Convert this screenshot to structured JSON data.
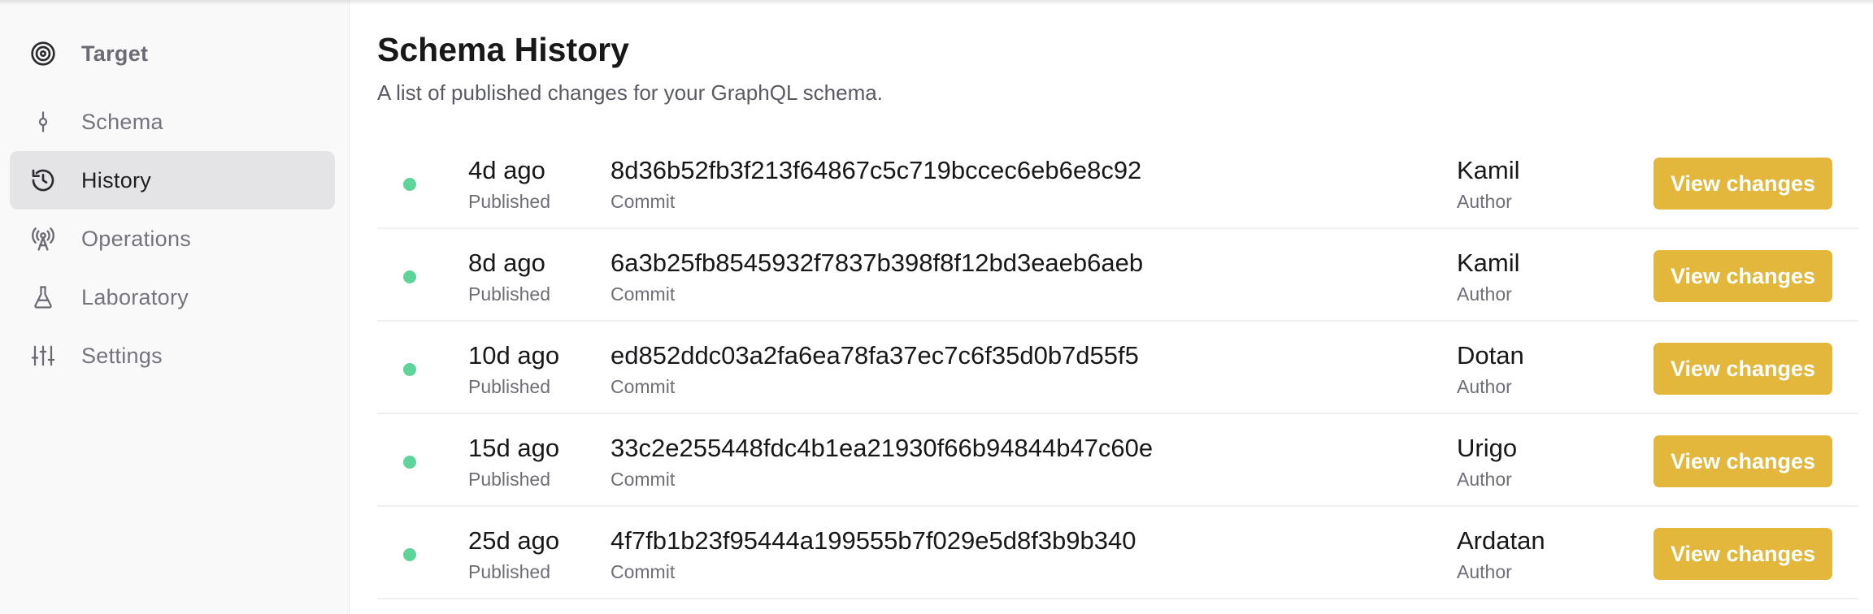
{
  "sidebar": {
    "header": {
      "label": "Target",
      "icon": "target-icon"
    },
    "items": [
      {
        "label": "Schema",
        "icon": "commit-icon"
      },
      {
        "label": "History",
        "icon": "history-icon",
        "active": true
      },
      {
        "label": "Operations",
        "icon": "broadcast-icon"
      },
      {
        "label": "Laboratory",
        "icon": "flask-icon"
      },
      {
        "label": "Settings",
        "icon": "sliders-icon"
      }
    ]
  },
  "main": {
    "title": "Schema History",
    "subtitle": "A list of published changes for your GraphQL schema.",
    "status_color": "#5fd49a",
    "button_color": "#e2b73c",
    "rows": [
      {
        "time": "4d ago",
        "status": "Published",
        "commit": "8d36b52fb3f213f64867c5c719bccec6eb6e8c92",
        "commit_label": "Commit",
        "author": "Kamil",
        "author_label": "Author",
        "button": "View changes"
      },
      {
        "time": "8d ago",
        "status": "Published",
        "commit": "6a3b25fb8545932f7837b398f8f12bd3eaeb6aeb",
        "commit_label": "Commit",
        "author": "Kamil",
        "author_label": "Author",
        "button": "View changes"
      },
      {
        "time": "10d ago",
        "status": "Published",
        "commit": "ed852ddc03a2fa6ea78fa37ec7c6f35d0b7d55f5",
        "commit_label": "Commit",
        "author": "Dotan",
        "author_label": "Author",
        "button": "View changes"
      },
      {
        "time": "15d ago",
        "status": "Published",
        "commit": "33c2e255448fdc4b1ea21930f66b94844b47c60e",
        "commit_label": "Commit",
        "author": "Urigo",
        "author_label": "Author",
        "button": "View changes"
      },
      {
        "time": "25d ago",
        "status": "Published",
        "commit": "4f7fb1b23f95444a199555b7f029e5d8f3b9b340",
        "commit_label": "Commit",
        "author": "Ardatan",
        "author_label": "Author",
        "button": "View changes"
      }
    ]
  }
}
